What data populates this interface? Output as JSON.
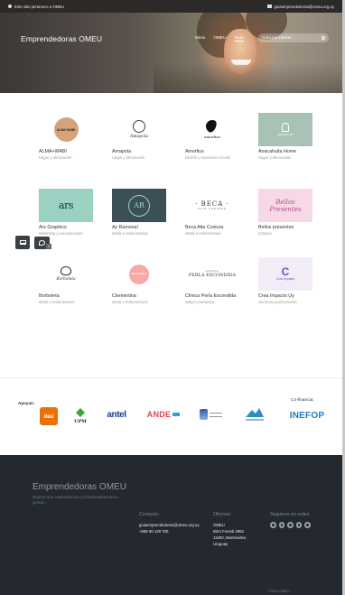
{
  "topbar": {
    "left_text": "Este sitio pertenece a OMEU",
    "right_text": "guiaemprendedoras@omeu.org.uy"
  },
  "header": {
    "brand": "Emprendedoras OMEU",
    "nav": [
      "Inicio",
      "OMEU",
      "Guía"
    ],
    "search_placeholder": "Guía por rubros"
  },
  "entrepreneurs": [
    {
      "name": "ALMA+WABI",
      "category": "Hogar y decoración",
      "logo_text": "ALMA+WABI"
    },
    {
      "name": "Amapola",
      "category": "Hogar y decoración",
      "logo_text": "Amapola"
    },
    {
      "name": "Amorfius",
      "category": "Diseño y economía circular",
      "logo_text": "amorfius"
    },
    {
      "name": "Anacahuita Home",
      "category": "Hogar y decoración",
      "logo_text": "ANACAHUITA"
    },
    {
      "name": "Ars Graphics",
      "category": "Marketing y comunicación",
      "logo_text": "Ars Graphics"
    },
    {
      "name": "Ay Ramona!",
      "category": "Moda e Indumentaria",
      "logo_text": "AR"
    },
    {
      "name": "Beca Alta Costura",
      "category": "Moda e Indumentaria",
      "logo_text": "· BECA ·",
      "logo_sub": "ALTA COSTURA"
    },
    {
      "name": "Bellos presentes",
      "category": "Infancia",
      "logo_text": "Bellos Presentes"
    },
    {
      "name": "Borboleta",
      "category": "Moda e Indumentaria",
      "logo_text": "Borboleta"
    },
    {
      "name": "Clementina",
      "category": "Moda e Indumentaria",
      "logo_text": "CLEMENTINA"
    },
    {
      "name": "Clínica Perla Escondida",
      "category": "Salud y bienestar",
      "logo_text": "PERLA ESCONDIDA",
      "logo_sub": "CLÍNICA"
    },
    {
      "name": "Crea Impacto Uy",
      "category": "Servicios profesionales",
      "logo_text": "Crea Impacto"
    }
  ],
  "sponsors": {
    "apoyan_label": "Apoyan:",
    "cofinancia_label": "Co-financia:",
    "logos": [
      "itaú",
      "UPM",
      "antel",
      "ANDE",
      "",
      "",
      "INEFOP"
    ]
  },
  "footer": {
    "title": "Emprendedoras OMEU",
    "description": "Mujeres que emprendemos y profesionalizamos su gestión.",
    "contact_heading": "Contacto:",
    "contact_email": "guiaemprendedoras@omeu.org.uy",
    "contact_phone": "+598 96 129 700",
    "offices_heading": "Oficinas:",
    "offices_lines": [
      "OMEU",
      "Brito Foresti 2952",
      "11600, Montevideo",
      "Uruguay"
    ],
    "social_heading": "Seguinos en redes:",
    "social_icons": [
      "instagram-icon",
      "facebook-icon",
      "linkedin-icon",
      "twitter-icon",
      "youtube-icon"
    ],
    "copyright": "©2024 OMEU"
  },
  "colors": {
    "topbar": "#2c2a28",
    "footer": "#23292e",
    "itau": "#ec7000",
    "antel": "#1f3f8f",
    "inefop": "#1d7bc4"
  }
}
